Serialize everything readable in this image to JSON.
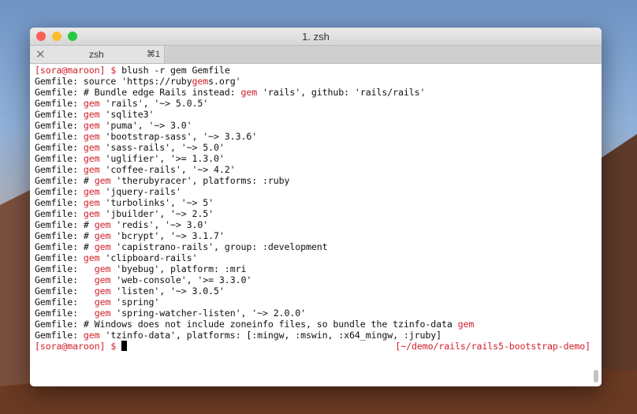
{
  "window": {
    "title": "1. zsh"
  },
  "tab": {
    "close": "✕",
    "name": "zsh",
    "shortcut": "⌘1"
  },
  "colors": {
    "highlight": "#d0202a",
    "close": "#fc5f57",
    "minimize": "#fdbc2e",
    "zoom": "#28c840"
  },
  "terminal": {
    "lines": [
      [
        [
          "[sora@maroon] $ ",
          "hl"
        ],
        [
          "blush -r gem Gemfile",
          ""
        ]
      ],
      [
        [
          "Gemfile: source 'https://ruby",
          ""
        ],
        [
          "gem",
          "hl"
        ],
        [
          "s.org'",
          ""
        ]
      ],
      [
        [
          "Gemfile: # Bundle edge Rails instead: ",
          ""
        ],
        [
          "gem",
          "hl"
        ],
        [
          " 'rails', github: 'rails/rails'",
          ""
        ]
      ],
      [
        [
          "Gemfile: ",
          ""
        ],
        [
          "gem",
          "hl"
        ],
        [
          " 'rails', '~> 5.0.5'",
          ""
        ]
      ],
      [
        [
          "Gemfile: ",
          ""
        ],
        [
          "gem",
          "hl"
        ],
        [
          " 'sqlite3'",
          ""
        ]
      ],
      [
        [
          "Gemfile: ",
          ""
        ],
        [
          "gem",
          "hl"
        ],
        [
          " 'puma', '~> 3.0'",
          ""
        ]
      ],
      [
        [
          "Gemfile: ",
          ""
        ],
        [
          "gem",
          "hl"
        ],
        [
          " 'bootstrap-sass', '~> 3.3.6'",
          ""
        ]
      ],
      [
        [
          "Gemfile: ",
          ""
        ],
        [
          "gem",
          "hl"
        ],
        [
          " 'sass-rails', '~> 5.0'",
          ""
        ]
      ],
      [
        [
          "Gemfile: ",
          ""
        ],
        [
          "gem",
          "hl"
        ],
        [
          " 'uglifier', '>= 1.3.0'",
          ""
        ]
      ],
      [
        [
          "Gemfile: ",
          ""
        ],
        [
          "gem",
          "hl"
        ],
        [
          " 'coffee-rails', '~> 4.2'",
          ""
        ]
      ],
      [
        [
          "Gemfile: # ",
          ""
        ],
        [
          "gem",
          "hl"
        ],
        [
          " 'therubyracer', platforms: :ruby",
          ""
        ]
      ],
      [
        [
          "Gemfile: ",
          ""
        ],
        [
          "gem",
          "hl"
        ],
        [
          " 'jquery-rails'",
          ""
        ]
      ],
      [
        [
          "Gemfile: ",
          ""
        ],
        [
          "gem",
          "hl"
        ],
        [
          " 'turbolinks', '~> 5'",
          ""
        ]
      ],
      [
        [
          "Gemfile: ",
          ""
        ],
        [
          "gem",
          "hl"
        ],
        [
          " 'jbuilder', '~> 2.5'",
          ""
        ]
      ],
      [
        [
          "Gemfile: # ",
          ""
        ],
        [
          "gem",
          "hl"
        ],
        [
          " 'redis', '~> 3.0'",
          ""
        ]
      ],
      [
        [
          "Gemfile: # ",
          ""
        ],
        [
          "gem",
          "hl"
        ],
        [
          " 'bcrypt', '~> 3.1.7'",
          ""
        ]
      ],
      [
        [
          "Gemfile: # ",
          ""
        ],
        [
          "gem",
          "hl"
        ],
        [
          " 'capistrano-rails', group: :development",
          ""
        ]
      ],
      [
        [
          "Gemfile: ",
          ""
        ],
        [
          "gem",
          "hl"
        ],
        [
          " 'clipboard-rails'",
          ""
        ]
      ],
      [
        [
          "Gemfile:   ",
          ""
        ],
        [
          "gem",
          "hl"
        ],
        [
          " 'byebug', platform: :mri",
          ""
        ]
      ],
      [
        [
          "Gemfile:   ",
          ""
        ],
        [
          "gem",
          "hl"
        ],
        [
          " 'web-console', '>= 3.3.0'",
          ""
        ]
      ],
      [
        [
          "Gemfile:   ",
          ""
        ],
        [
          "gem",
          "hl"
        ],
        [
          " 'listen', '~> 3.0.5'",
          ""
        ]
      ],
      [
        [
          "Gemfile:   ",
          ""
        ],
        [
          "gem",
          "hl"
        ],
        [
          " 'spring'",
          ""
        ]
      ],
      [
        [
          "Gemfile:   ",
          ""
        ],
        [
          "gem",
          "hl"
        ],
        [
          " 'spring-watcher-listen', '~> 2.0.0'",
          ""
        ]
      ],
      [
        [
          "Gemfile: # Windows does not include zoneinfo files, so bundle the tzinfo-data ",
          ""
        ],
        [
          "gem",
          "hl"
        ]
      ],
      [
        [
          "Gemfile: ",
          ""
        ],
        [
          "gem",
          "hl"
        ],
        [
          " 'tzinfo-data', platforms: [:mingw, :mswin, :x64_mingw, :jruby]",
          ""
        ]
      ]
    ],
    "prompt": "[sora@maroon] $ ",
    "right_prompt": "[~/demo/rails/rails5-bootstrap-demo]"
  }
}
